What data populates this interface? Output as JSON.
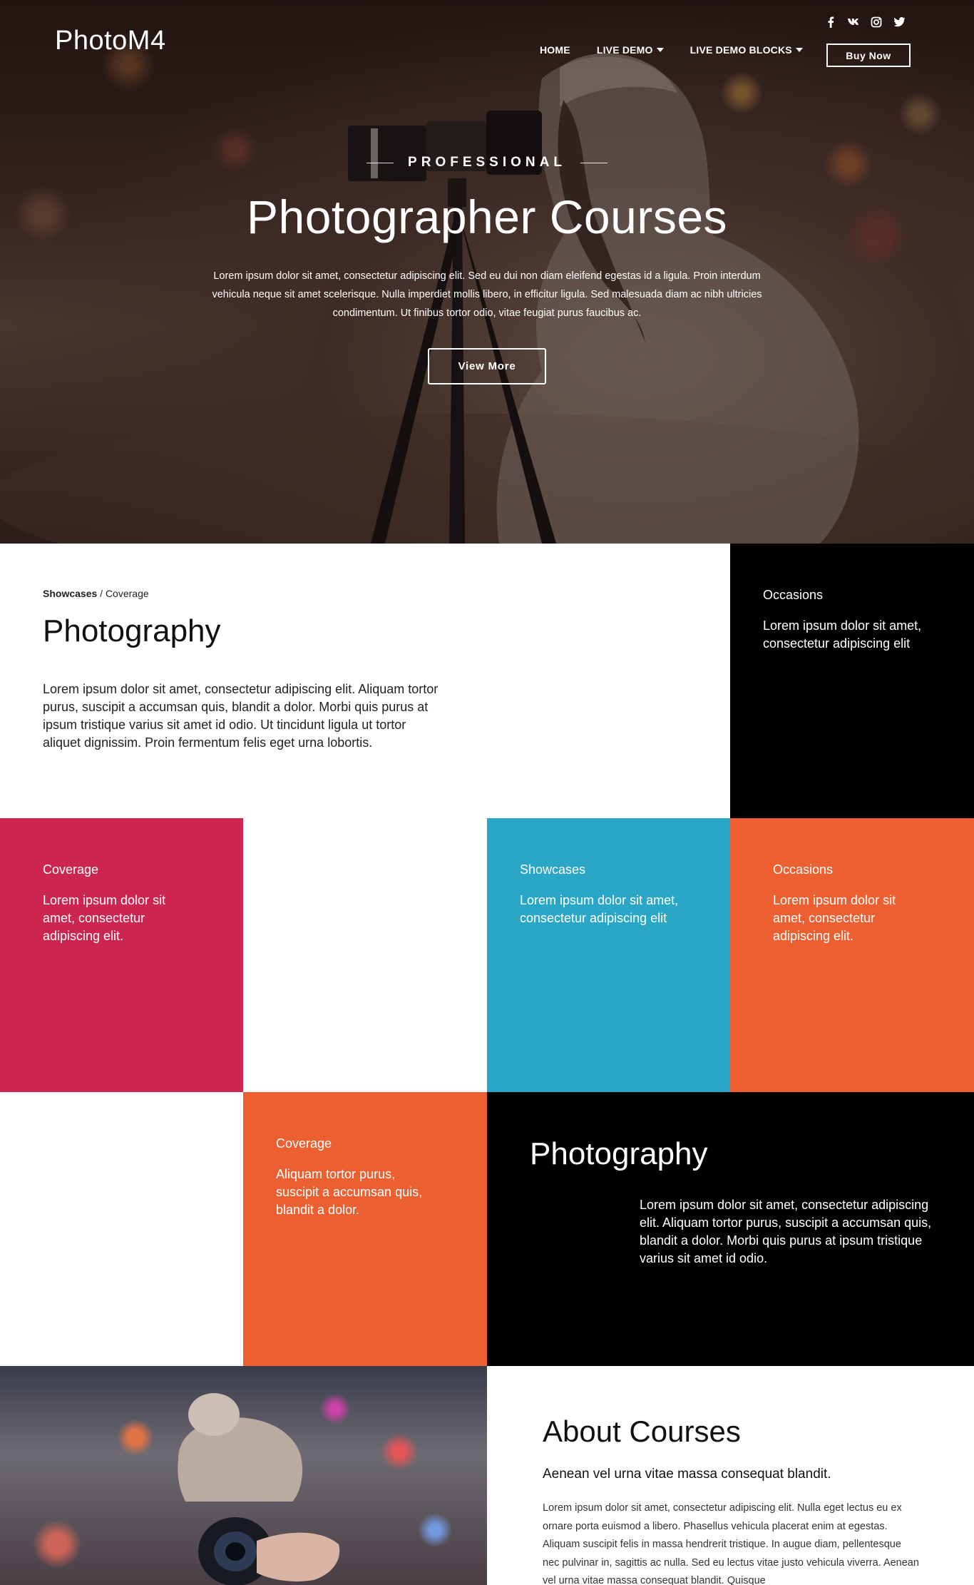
{
  "header": {
    "brand": "PhotoM4",
    "social": [
      "facebook-icon",
      "vk-icon",
      "instagram-icon",
      "twitter-icon"
    ],
    "nav": [
      {
        "label": "HOME",
        "dropdown": false
      },
      {
        "label": "LIVE DEMO",
        "dropdown": true
      },
      {
        "label": "LIVE DEMO BLOCKS",
        "dropdown": true
      }
    ],
    "buy_label": "Buy Now"
  },
  "hero": {
    "eyebrow": "PROFESSIONAL",
    "title": "Photographer Courses",
    "text": "Lorem ipsum dolor sit amet, consectetur adipiscing elit. Sed eu dui non diam eleifend egestas id a ligula. Proin interdum vehicula neque sit amet scelerisque. Nulla imperdiet mollis libero, in efficitur ligula. Sed malesuada diam ac nibh ultricies condimentum. Ut finibus tortor odio, vitae feugiat purus faucibus ac.",
    "button": "View More"
  },
  "intro": {
    "breadcrumb_current": "Showcases",
    "breadcrumb_sep": " / ",
    "breadcrumb_parent": "Coverage",
    "title": "Photography",
    "text": "Lorem ipsum dolor sit amet, consectetur adipiscing elit. Aliquam tortor purus, suscipit a accumsan quis, blandit a dolor. Morbi quis purus at ipsum tristique varius sit amet id odio. Ut tincidunt ligula ut tortor aliquet dignissim. Proin fermentum felis eget urna lobortis."
  },
  "tiles": {
    "occasions_black": {
      "title": "Occasions",
      "text": "Lorem ipsum dolor sit amet, consectetur adipiscing elit"
    },
    "coverage_crimson": {
      "title": "Coverage",
      "text": "Lorem ipsum dolor sit amet, consectetur adipiscing elit."
    },
    "showcases_blue": {
      "title": "Showcases",
      "text": "Lorem ipsum dolor sit amet, consectetur adipiscing elit"
    },
    "occasions_orange": {
      "title": "Occasions",
      "text": "Lorem ipsum dolor sit amet, consectetur adipiscing elit."
    },
    "coverage_orange": {
      "title": "Coverage",
      "text": "Aliquam tortor purus, suscipit a accumsan quis, blandit a dolor."
    },
    "photography_black": {
      "title": "Photography",
      "text": "Lorem ipsum dolor sit amet, consectetur adipiscing elit. Aliquam tortor purus, suscipit a accumsan quis, blandit a dolor. Morbi quis purus at ipsum tristique varius sit amet id odio."
    }
  },
  "about": {
    "title": "About Courses",
    "subtitle": "Aenean vel urna vitae massa consequat blandit.",
    "text": "Lorem ipsum dolor sit amet, consectetur adipiscing elit. Nulla eget lectus eu ex ornare porta euismod a libero. Phasellus vehicula placerat enim at egestas. Aliquam suscipit felis in massa hendrerit tristique. In augue diam, pellentesque nec pulvinar in, sagittis ac nulla. Sed eu lectus vitae justo vehicula viverra. Aenean vel urna vitae massa consequat blandit. Quisque"
  },
  "colors": {
    "crimson": "#cc2650",
    "blue": "#2aa6c6",
    "orange": "#eb5f30",
    "black": "#000000"
  }
}
